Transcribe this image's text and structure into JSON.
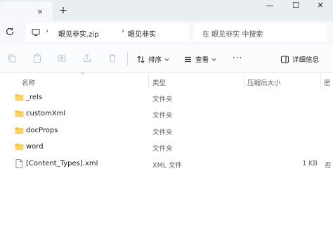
{
  "window": {
    "tab_close": "×",
    "new_tab": "+",
    "minimize": "—",
    "maximize": "☐",
    "close": "✕"
  },
  "address": {
    "crumbs": [
      "眼见非实.zip",
      "眼见非实"
    ],
    "separator": "›",
    "search_placeholder": "在 眼见非实 中搜索"
  },
  "toolbar": {
    "sort_label": "排序",
    "view_label": "查看",
    "more_label": "···",
    "details_label": "详细信息"
  },
  "columns": {
    "name": "名称",
    "type": "类型",
    "compressed_size": "压缩后大小",
    "extra": "密"
  },
  "files": [
    {
      "name": "_rels",
      "type": "文件夹",
      "size": "",
      "extra": "",
      "icon": "folder-icon"
    },
    {
      "name": "customXml",
      "type": "文件夹",
      "size": "",
      "extra": "",
      "icon": "folder-icon"
    },
    {
      "name": "docProps",
      "type": "文件夹",
      "size": "",
      "extra": "",
      "icon": "folder-icon"
    },
    {
      "name": "word",
      "type": "文件夹",
      "size": "",
      "extra": "",
      "icon": "folder-icon"
    },
    {
      "name": "[Content_Types].xml",
      "type": "XML 文件",
      "size": "1 KB",
      "extra": "否",
      "icon": "file-icon"
    }
  ],
  "colors": {
    "folder": "#f4c24f",
    "accent": "#0067c0",
    "titlebar": "#e9eef3"
  }
}
